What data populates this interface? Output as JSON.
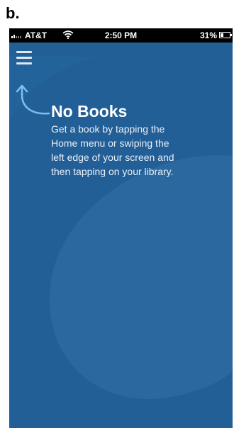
{
  "figure_label": "b.",
  "status_bar": {
    "carrier": "AT&T",
    "time": "2:50 PM",
    "battery": "31%",
    "battery_level": 0.31,
    "signal_icon": "signal-bars-icon",
    "wifi_icon": "wifi-icon"
  },
  "nav": {
    "menu_icon": "hamburger-menu-icon"
  },
  "empty_state": {
    "title": "No Books",
    "line1": "Get a book by tapping the",
    "line2": "Home menu or swiping the",
    "line3": "left edge of your screen and",
    "line4": "then tapping on your library.",
    "hint_icon": "curved-arrow-up-icon"
  },
  "colors": {
    "background": "#225f97",
    "swirl": "#2b6aa3",
    "status_bar": "#000000",
    "accent": "#7cc0ee"
  }
}
